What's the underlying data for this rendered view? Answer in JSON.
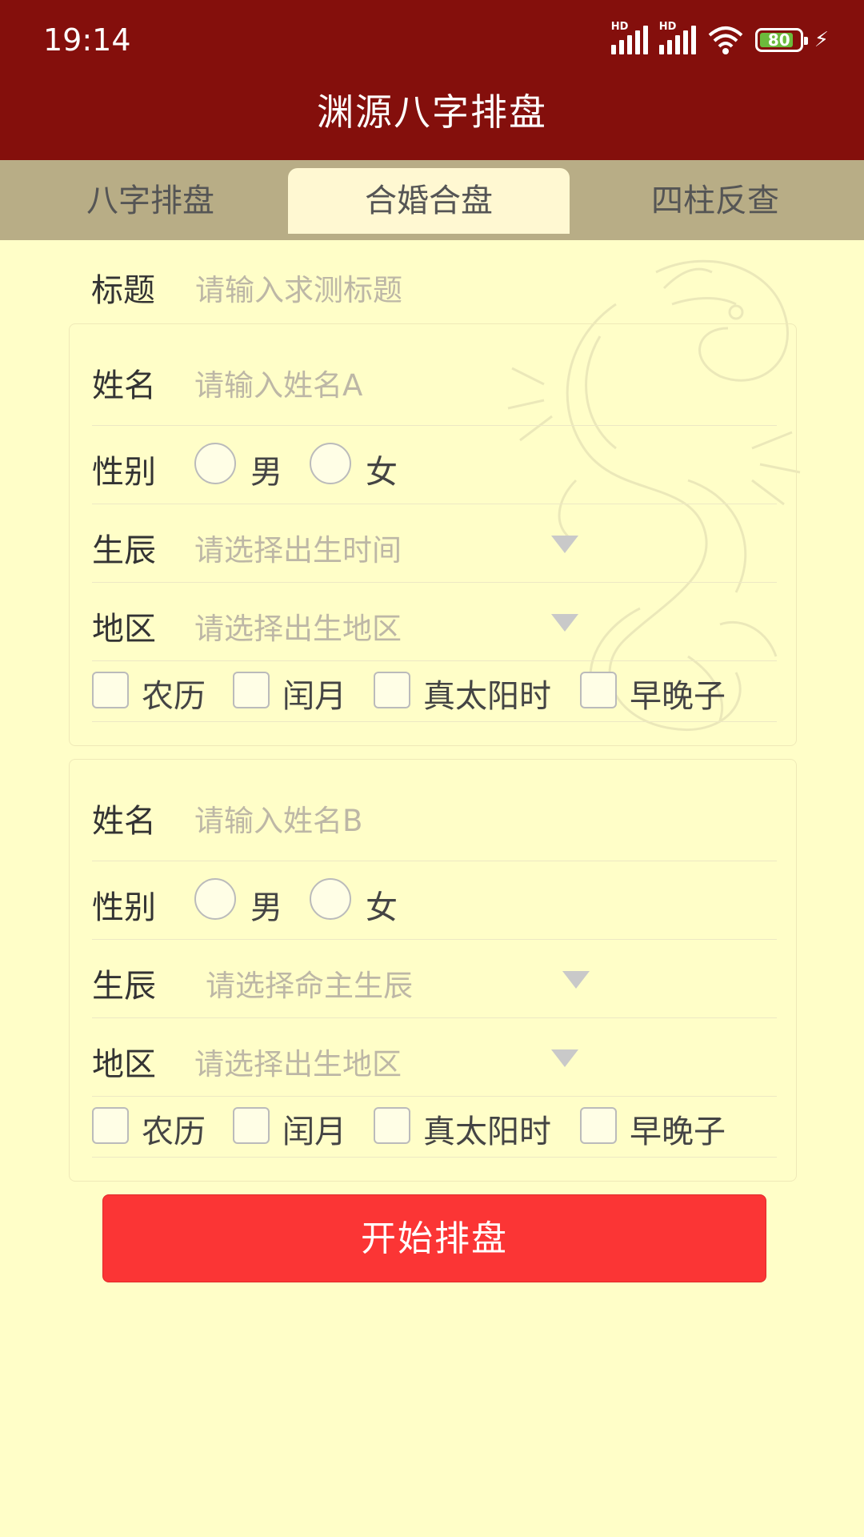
{
  "status": {
    "time": "19:14",
    "battery": "80",
    "network1": "HD",
    "network2": "HD"
  },
  "app": {
    "title": "渊源八字排盘"
  },
  "tabs": [
    {
      "label": "八字排盘",
      "active": false
    },
    {
      "label": "合婚合盘",
      "active": true
    },
    {
      "label": "四柱反查",
      "active": false
    }
  ],
  "form": {
    "title_label": "标题",
    "title_placeholder": "请输入求测标题",
    "person_a": {
      "name_label": "姓名",
      "name_placeholder": "请输入姓名A",
      "gender_label": "性别",
      "gender_options": [
        "男",
        "女"
      ],
      "birth_label": "生辰",
      "birth_placeholder": "请选择出生时间",
      "region_label": "地区",
      "region_placeholder": "请选择出生地区",
      "checkboxes": [
        "农历",
        "闰月",
        "真太阳时",
        "早晚子"
      ]
    },
    "person_b": {
      "name_label": "姓名",
      "name_placeholder": "请输入姓名B",
      "gender_label": "性别",
      "gender_options": [
        "男",
        "女"
      ],
      "birth_label": "生辰",
      "birth_placeholder": "请选择命主生辰",
      "region_label": "地区",
      "region_placeholder": "请选择出生地区",
      "checkboxes": [
        "农历",
        "闰月",
        "真太阳时",
        "早晚子"
      ]
    },
    "submit_label": "开始排盘"
  },
  "colors": {
    "header": "#840F0C",
    "tabbar": "#B8AD86",
    "background": "#FFFEC8",
    "button": "#FB3535"
  }
}
